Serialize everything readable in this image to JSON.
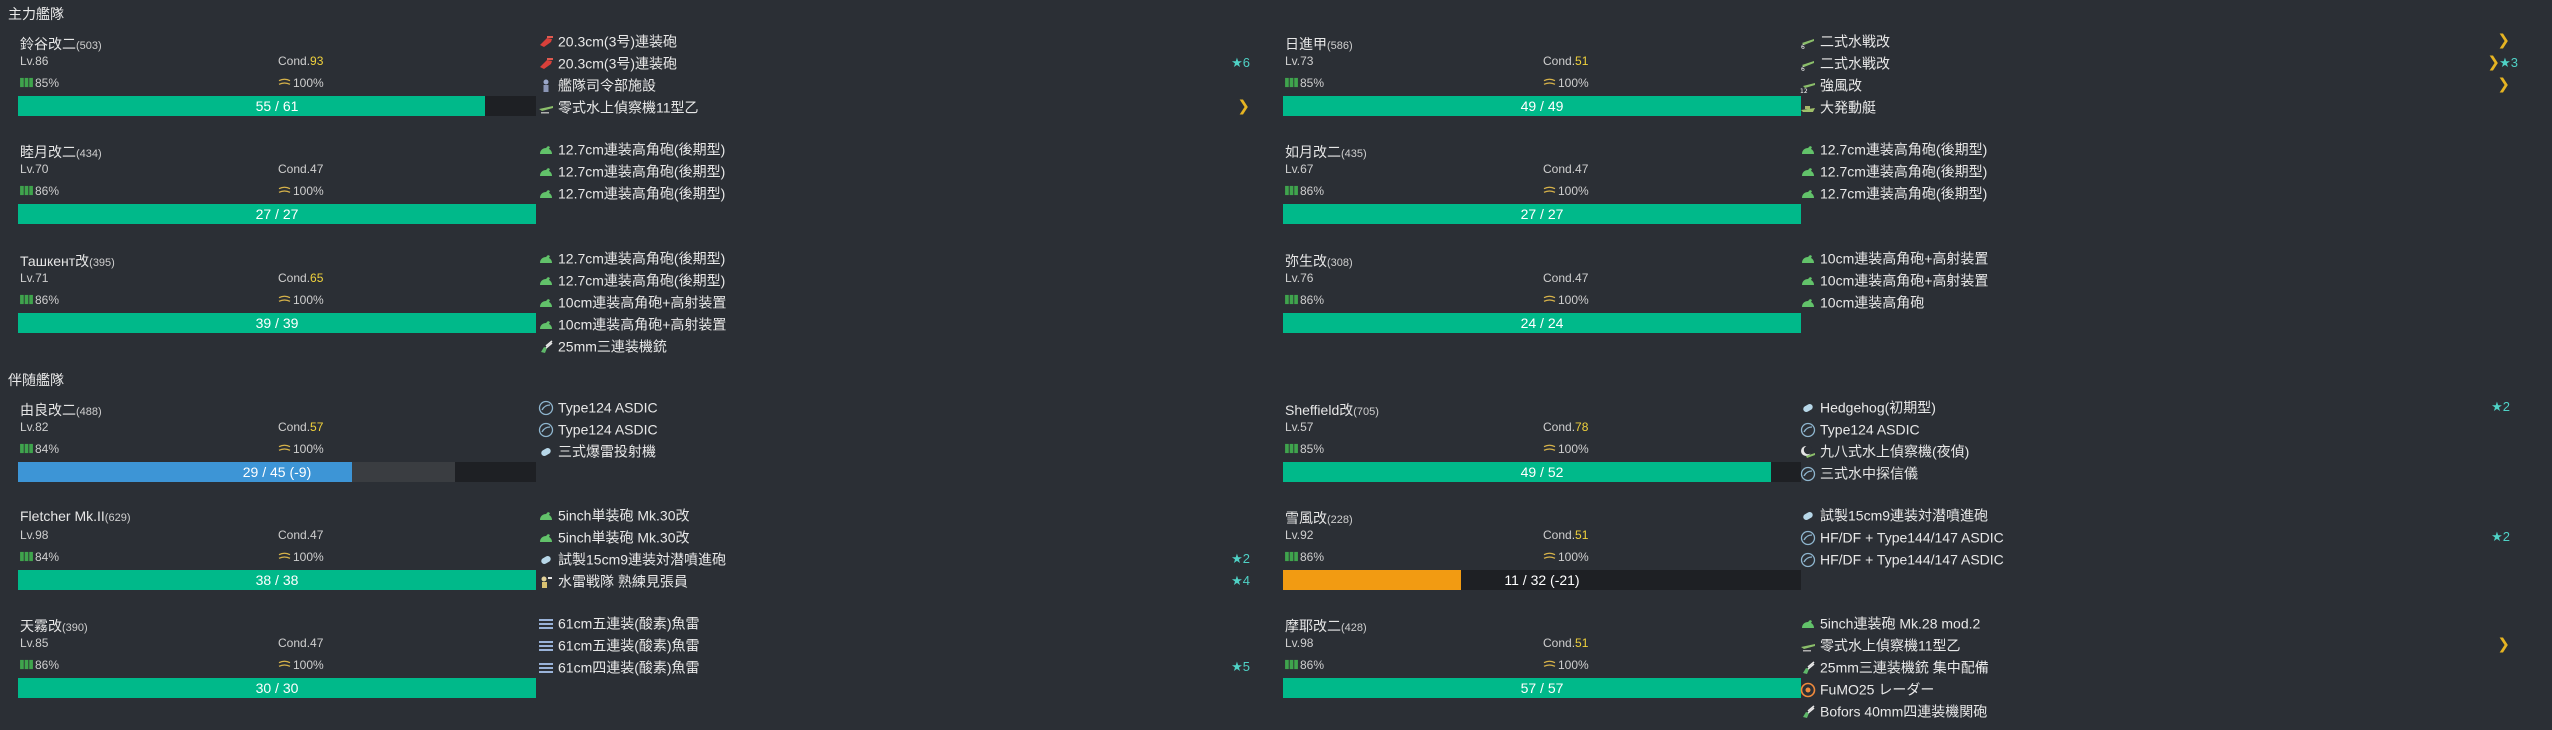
{
  "colors": {
    "background": "#2b2f35",
    "hp_green": "#00b98a",
    "hp_blue": "#3d95d6",
    "hp_orange": "#f29b12",
    "cond_sparkle": "#f0d23c",
    "improve": "#4fd1c5",
    "proficiency": "#e6b422"
  },
  "fleets": [
    {
      "title": "主力艦隊",
      "ships": [
        {
          "name": "鈴谷改二",
          "id": "(503)",
          "lv": "Lv.86",
          "cond_label": "Cond.",
          "cond": "93",
          "cond_sparkle": true,
          "fuel": "85%",
          "ammo": "100%",
          "hp_text": "55 / 61",
          "hp_ratio": 0.9016,
          "hp_color": "green",
          "equips": [
            {
              "icon": "heavy-gun-icon",
              "name": "20.3cm(3号)連装砲",
              "stars": "",
              "prof": ""
            },
            {
              "icon": "heavy-gun-icon",
              "name": "20.3cm(3号)連装砲",
              "stars": "★6",
              "prof": ""
            },
            {
              "icon": "facility-icon",
              "name": "艦隊司令部施設",
              "stars": "",
              "prof": ""
            },
            {
              "icon": "seaplane-icon",
              "name": "零式水上偵察機11型乙",
              "stars": "",
              "prof": "❯"
            }
          ]
        },
        {
          "name": "日進甲",
          "id": "(586)",
          "lv": "Lv.73",
          "cond_label": "Cond.",
          "cond": "51",
          "cond_sparkle": true,
          "fuel": "85%",
          "ammo": "100%",
          "hp_text": "49 / 49",
          "hp_ratio": 1.0,
          "hp_color": "green",
          "equips": [
            {
              "icon": "midget-sub-icon",
              "name": "二式水戦改",
              "stars": "",
              "prof": "❯"
            },
            {
              "icon": "midget-sub-icon",
              "name": "二式水戦改",
              "stars": "★3",
              "prof": "❯"
            },
            {
              "icon": "seaplane-fighter-icon",
              "name": "強風改",
              "stars": "",
              "prof": "❯"
            },
            {
              "icon": "landing-craft-icon",
              "name": "大発動艇",
              "stars": "",
              "prof": ""
            }
          ]
        },
        {
          "name": "睦月改二",
          "id": "(434)",
          "lv": "Lv.70",
          "cond_label": "Cond.",
          "cond": "47",
          "cond_sparkle": false,
          "fuel": "86%",
          "ammo": "100%",
          "hp_text": "27 / 27",
          "hp_ratio": 1.0,
          "hp_color": "green",
          "equips": [
            {
              "icon": "small-gun-icon",
              "name": "12.7cm連装高角砲(後期型)",
              "stars": "",
              "prof": ""
            },
            {
              "icon": "small-gun-icon",
              "name": "12.7cm連装高角砲(後期型)",
              "stars": "",
              "prof": ""
            },
            {
              "icon": "small-gun-icon",
              "name": "12.7cm連装高角砲(後期型)",
              "stars": "",
              "prof": ""
            }
          ]
        },
        {
          "name": "如月改二",
          "id": "(435)",
          "lv": "Lv.67",
          "cond_label": "Cond.",
          "cond": "47",
          "cond_sparkle": false,
          "fuel": "86%",
          "ammo": "100%",
          "hp_text": "27 / 27",
          "hp_ratio": 1.0,
          "hp_color": "green",
          "equips": [
            {
              "icon": "small-gun-icon",
              "name": "12.7cm連装高角砲(後期型)",
              "stars": "",
              "prof": ""
            },
            {
              "icon": "small-gun-icon",
              "name": "12.7cm連装高角砲(後期型)",
              "stars": "",
              "prof": ""
            },
            {
              "icon": "small-gun-icon",
              "name": "12.7cm連装高角砲(後期型)",
              "stars": "",
              "prof": ""
            }
          ]
        },
        {
          "name": "Ташкент改",
          "id": "(395)",
          "lv": "Lv.71",
          "cond_label": "Cond.",
          "cond": "65",
          "cond_sparkle": true,
          "fuel": "86%",
          "ammo": "100%",
          "hp_text": "39 / 39",
          "hp_ratio": 1.0,
          "hp_color": "green",
          "equips": [
            {
              "icon": "small-gun-icon",
              "name": "12.7cm連装高角砲(後期型)",
              "stars": "",
              "prof": ""
            },
            {
              "icon": "small-gun-icon",
              "name": "12.7cm連装高角砲(後期型)",
              "stars": "",
              "prof": ""
            },
            {
              "icon": "small-gun-icon",
              "name": "10cm連装高角砲+高射装置",
              "stars": "",
              "prof": ""
            },
            {
              "icon": "small-gun-icon",
              "name": "10cm連装高角砲+高射装置",
              "stars": "",
              "prof": ""
            },
            {
              "icon": "aa-gun-icon",
              "name": "25mm三連装機銃",
              "stars": "",
              "prof": ""
            }
          ]
        },
        {
          "name": "弥生改",
          "id": "(308)",
          "lv": "Lv.76",
          "cond_label": "Cond.",
          "cond": "47",
          "cond_sparkle": false,
          "fuel": "86%",
          "ammo": "100%",
          "hp_text": "24 / 24",
          "hp_ratio": 1.0,
          "hp_color": "green",
          "equips": [
            {
              "icon": "small-gun-icon",
              "name": "10cm連装高角砲+高射装置",
              "stars": "",
              "prof": ""
            },
            {
              "icon": "small-gun-icon",
              "name": "10cm連装高角砲+高射装置",
              "stars": "",
              "prof": ""
            },
            {
              "icon": "small-gun-icon",
              "name": "10cm連装高角砲",
              "stars": "",
              "prof": ""
            }
          ]
        }
      ]
    },
    {
      "title": "伴随艦隊",
      "ships": [
        {
          "name": "由良改二",
          "id": "(488)",
          "lv": "Lv.82",
          "cond_label": "Cond.",
          "cond": "57",
          "cond_sparkle": true,
          "fuel": "84%",
          "ammo": "100%",
          "hp_text": "29 / 45 (-9)",
          "hp_ratio": 0.6444,
          "hp_color": "blue",
          "hp_damage_ratio": 0.2,
          "equips": [
            {
              "icon": "sonar-icon",
              "name": "Type124 ASDIC",
              "stars": "",
              "prof": ""
            },
            {
              "icon": "sonar-icon",
              "name": "Type124 ASDIC",
              "stars": "",
              "prof": ""
            },
            {
              "icon": "depth-charge-icon",
              "name": "三式爆雷投射機",
              "stars": "",
              "prof": ""
            }
          ]
        },
        {
          "name": "Sheffield改",
          "id": "(705)",
          "lv": "Lv.57",
          "cond_label": "Cond.",
          "cond": "78",
          "cond_sparkle": true,
          "fuel": "85%",
          "ammo": "100%",
          "hp_text": "49 / 52",
          "hp_ratio": 0.9423,
          "hp_color": "green",
          "equips": [
            {
              "icon": "depth-charge-icon",
              "name": "Hedgehog(初期型)",
              "stars": "★2",
              "prof": ""
            },
            {
              "icon": "sonar-icon",
              "name": "Type124 ASDIC",
              "stars": "",
              "prof": ""
            },
            {
              "icon": "night-recon-icon",
              "name": "九八式水上偵察機(夜偵)",
              "stars": "",
              "prof": ""
            },
            {
              "icon": "sonar-icon",
              "name": "三式水中探信儀",
              "stars": "",
              "prof": ""
            }
          ]
        },
        {
          "name": "Fletcher Mk.II",
          "id": "(629)",
          "lv": "Lv.98",
          "cond_label": "Cond.",
          "cond": "47",
          "cond_sparkle": false,
          "fuel": "84%",
          "ammo": "100%",
          "hp_text": "38 / 38",
          "hp_ratio": 1.0,
          "hp_color": "green",
          "equips": [
            {
              "icon": "small-gun-icon",
              "name": "5inch単装砲 Mk.30改",
              "stars": "",
              "prof": ""
            },
            {
              "icon": "small-gun-icon",
              "name": "5inch単装砲 Mk.30改",
              "stars": "",
              "prof": ""
            },
            {
              "icon": "depth-charge-icon",
              "name": "試製15cm9連装対潜噴進砲",
              "stars": "★2",
              "prof": ""
            },
            {
              "icon": "lookout-icon",
              "name": "水雷戦隊 熟練見張員",
              "stars": "★4",
              "prof": ""
            }
          ]
        },
        {
          "name": "雪風改",
          "id": "(228)",
          "lv": "Lv.92",
          "cond_label": "Cond.",
          "cond": "51",
          "cond_sparkle": true,
          "fuel": "86%",
          "ammo": "100%",
          "hp_text": "11 / 32 (-21)",
          "hp_ratio": 0.3438,
          "hp_color": "orange",
          "equips": [
            {
              "icon": "depth-charge-icon",
              "name": "試製15cm9連装対潜噴進砲",
              "stars": "",
              "prof": ""
            },
            {
              "icon": "sonar-icon",
              "name": "HF/DF + Type144/147 ASDIC",
              "stars": "★2",
              "prof": ""
            },
            {
              "icon": "sonar-icon",
              "name": "HF/DF + Type144/147 ASDIC",
              "stars": "",
              "prof": ""
            }
          ]
        },
        {
          "name": "天霧改",
          "id": "(390)",
          "lv": "Lv.85",
          "cond_label": "Cond.",
          "cond": "47",
          "cond_sparkle": false,
          "fuel": "86%",
          "ammo": "100%",
          "hp_text": "30 / 30",
          "hp_ratio": 1.0,
          "hp_color": "green",
          "equips": [
            {
              "icon": "torpedo-icon",
              "name": "61cm五連装(酸素)魚雷",
              "stars": "",
              "prof": ""
            },
            {
              "icon": "torpedo-icon",
              "name": "61cm五連装(酸素)魚雷",
              "stars": "",
              "prof": ""
            },
            {
              "icon": "torpedo-icon",
              "name": "61cm四連装(酸素)魚雷",
              "stars": "★5",
              "prof": ""
            }
          ]
        },
        {
          "name": "摩耶改二",
          "id": "(428)",
          "lv": "Lv.98",
          "cond_label": "Cond.",
          "cond": "51",
          "cond_sparkle": true,
          "fuel": "86%",
          "ammo": "100%",
          "hp_text": "57 / 57",
          "hp_ratio": 1.0,
          "hp_color": "green",
          "equips": [
            {
              "icon": "small-gun-icon",
              "name": "5inch連装砲 Mk.28 mod.2",
              "stars": "",
              "prof": ""
            },
            {
              "icon": "seaplane-icon",
              "name": "零式水上偵察機11型乙",
              "stars": "",
              "prof": "❯"
            },
            {
              "icon": "aa-gun-icon",
              "name": "25mm三連装機銃 集中配備",
              "stars": "",
              "prof": ""
            },
            {
              "icon": "aa-radar-icon",
              "name": "FuMO25 レーダー",
              "stars": "",
              "prof": ""
            },
            {
              "icon": "aa-gun-icon",
              "name": "Bofors 40mm四連装機関砲",
              "stars": "",
              "prof": ""
            }
          ]
        }
      ]
    }
  ]
}
